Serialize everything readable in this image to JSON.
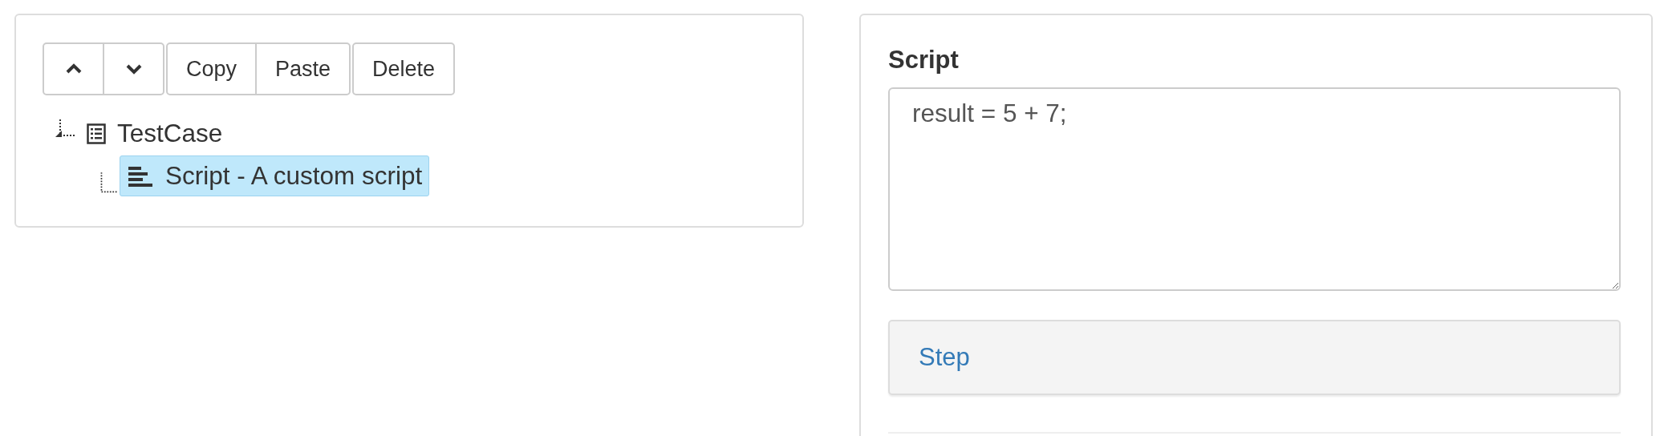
{
  "toolbar": [
    {
      "kind": "up"
    },
    {
      "kind": "down"
    },
    {
      "kind": "text",
      "label": "Copy"
    },
    {
      "kind": "text",
      "label": "Paste"
    },
    {
      "kind": "text",
      "label": "Delete"
    }
  ],
  "tree": [
    {
      "label": "TestCase",
      "kind": "list",
      "selected": false,
      "children": [
        {
          "label": "Script - A custom script",
          "kind": "script",
          "selected": true
        }
      ]
    }
  ],
  "editor": {
    "title": "Script",
    "value": "result = 5 + 7;"
  },
  "panel": {
    "title": "Step"
  }
}
